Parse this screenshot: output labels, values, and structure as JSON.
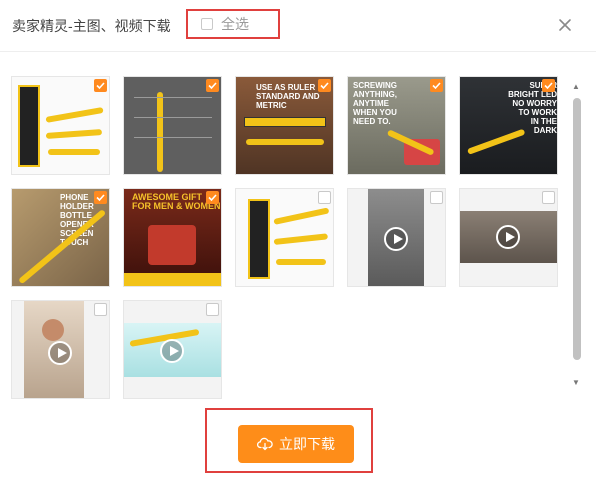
{
  "header": {
    "title": "卖家精灵-主图、视频下载",
    "select_all_label": "全选",
    "close_icon": "close-icon"
  },
  "thumbnails": [
    {
      "name": "thumb-1",
      "checked": true,
      "type": "image",
      "caption": "",
      "bg": "#fafafa"
    },
    {
      "name": "thumb-2",
      "checked": true,
      "type": "image",
      "caption": "",
      "bg": "#5f5f5f"
    },
    {
      "name": "thumb-3",
      "checked": true,
      "type": "image",
      "caption": "USE AS RULER\nSTANDARD AND METRIC",
      "bg": "#8a5a3a"
    },
    {
      "name": "thumb-4",
      "checked": true,
      "type": "image",
      "caption": "SCREWING\nANYTHING,\nANYTIME\nWHEN YOU\nNEED TO.",
      "bg": "#9a9a8c"
    },
    {
      "name": "thumb-5",
      "checked": true,
      "type": "image",
      "caption": "SUPER\nBRIGHT LED\nNO WORRY\nTO WORK\nIN THE DARK",
      "bg": "#2f3236"
    },
    {
      "name": "thumb-6",
      "checked": true,
      "type": "image",
      "caption": "PHONE\nHOLDER\nBOTTLE\nOPENER\nSCREEN\nTOUCH",
      "bg": "#b79b6e"
    },
    {
      "name": "thumb-7",
      "checked": true,
      "type": "image",
      "caption": "AWESOME GIFT\nFOR MEN & WOMEN",
      "bg": "#5a1d14"
    },
    {
      "name": "thumb-8",
      "checked": false,
      "type": "image",
      "caption": "",
      "bg": "#fafafa"
    },
    {
      "name": "thumb-9",
      "checked": false,
      "type": "video",
      "caption": "",
      "bg": "#7a7a7a"
    },
    {
      "name": "thumb-10",
      "checked": false,
      "type": "video",
      "caption": "",
      "bg": "#8a7f74"
    },
    {
      "name": "thumb-11",
      "checked": false,
      "type": "video",
      "caption": "",
      "bg": "#d9c9b8"
    },
    {
      "name": "thumb-12",
      "checked": false,
      "type": "video",
      "caption": "",
      "bg": "#cfeff0"
    }
  ],
  "footer": {
    "download_label": "立即下载",
    "download_icon": "cloud-download-icon"
  },
  "colors": {
    "accent": "#fe8d19",
    "highlight_frame": "#e0403e",
    "checkbox_on": "#ff8a1f"
  }
}
